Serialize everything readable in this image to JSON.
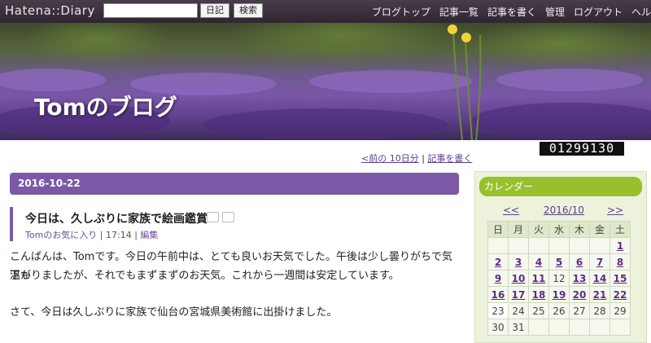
{
  "topbar": {
    "logo": "Hatena::Diary",
    "search_value": "",
    "diary_button": "日記",
    "search_button": "検索",
    "nav": [
      "ブログトップ",
      "記事一覧",
      "記事を書く",
      "管理",
      "ログアウト",
      "ヘルプ"
    ]
  },
  "header": {
    "blog_title": "Tomのブログ"
  },
  "counter": "01299130",
  "pagenav": {
    "prev": "<前の 10日分",
    "write": "記事を書く"
  },
  "entry": {
    "date": "2016-10-22",
    "title": "今日は、久しぶりに家族で絵画鑑賞",
    "category": "Tomのお気に入り",
    "time": "17:14",
    "edit": "編集",
    "paragraphs": [
      "こんばんは、Tomです。今日の午前中は、とても良いお天気でした。午後は少し曇りがちで気温も",
      "下がりましたが、それでもまずまずのお天気。これから一週間は安定しています。",
      "さて、今日は久しぶりに家族で仙台の宮城県美術館に出掛けました。"
    ]
  },
  "calendar": {
    "heading": "カレンダー",
    "prev": "<<",
    "month": "2016/10",
    "next": ">>",
    "weekdays": [
      "日",
      "月",
      "火",
      "水",
      "木",
      "金",
      "土"
    ],
    "weeks": [
      [
        "",
        "",
        "",
        "",
        "",
        "",
        "1"
      ],
      [
        "2",
        "3",
        "4",
        "5",
        "6",
        "7",
        "8"
      ],
      [
        "9",
        "10",
        "11",
        "12",
        "13",
        "14",
        "15"
      ],
      [
        "16",
        "17",
        "18",
        "19",
        "20",
        "21",
        "22"
      ],
      [
        "23",
        "24",
        "25",
        "26",
        "27",
        "28",
        "29"
      ],
      [
        "30",
        "31",
        "",
        "",
        "",
        "",
        ""
      ]
    ],
    "linked_days": [
      "1",
      "2",
      "3",
      "4",
      "5",
      "6",
      "7",
      "8",
      "9",
      "10",
      "11",
      "13",
      "14",
      "15",
      "16",
      "17",
      "18",
      "19",
      "20",
      "21",
      "22"
    ],
    "today": "23"
  },
  "colors": {
    "accent": "#7c59a6",
    "sidebar_head": "#98c02c",
    "link": "#5b2d8c"
  }
}
